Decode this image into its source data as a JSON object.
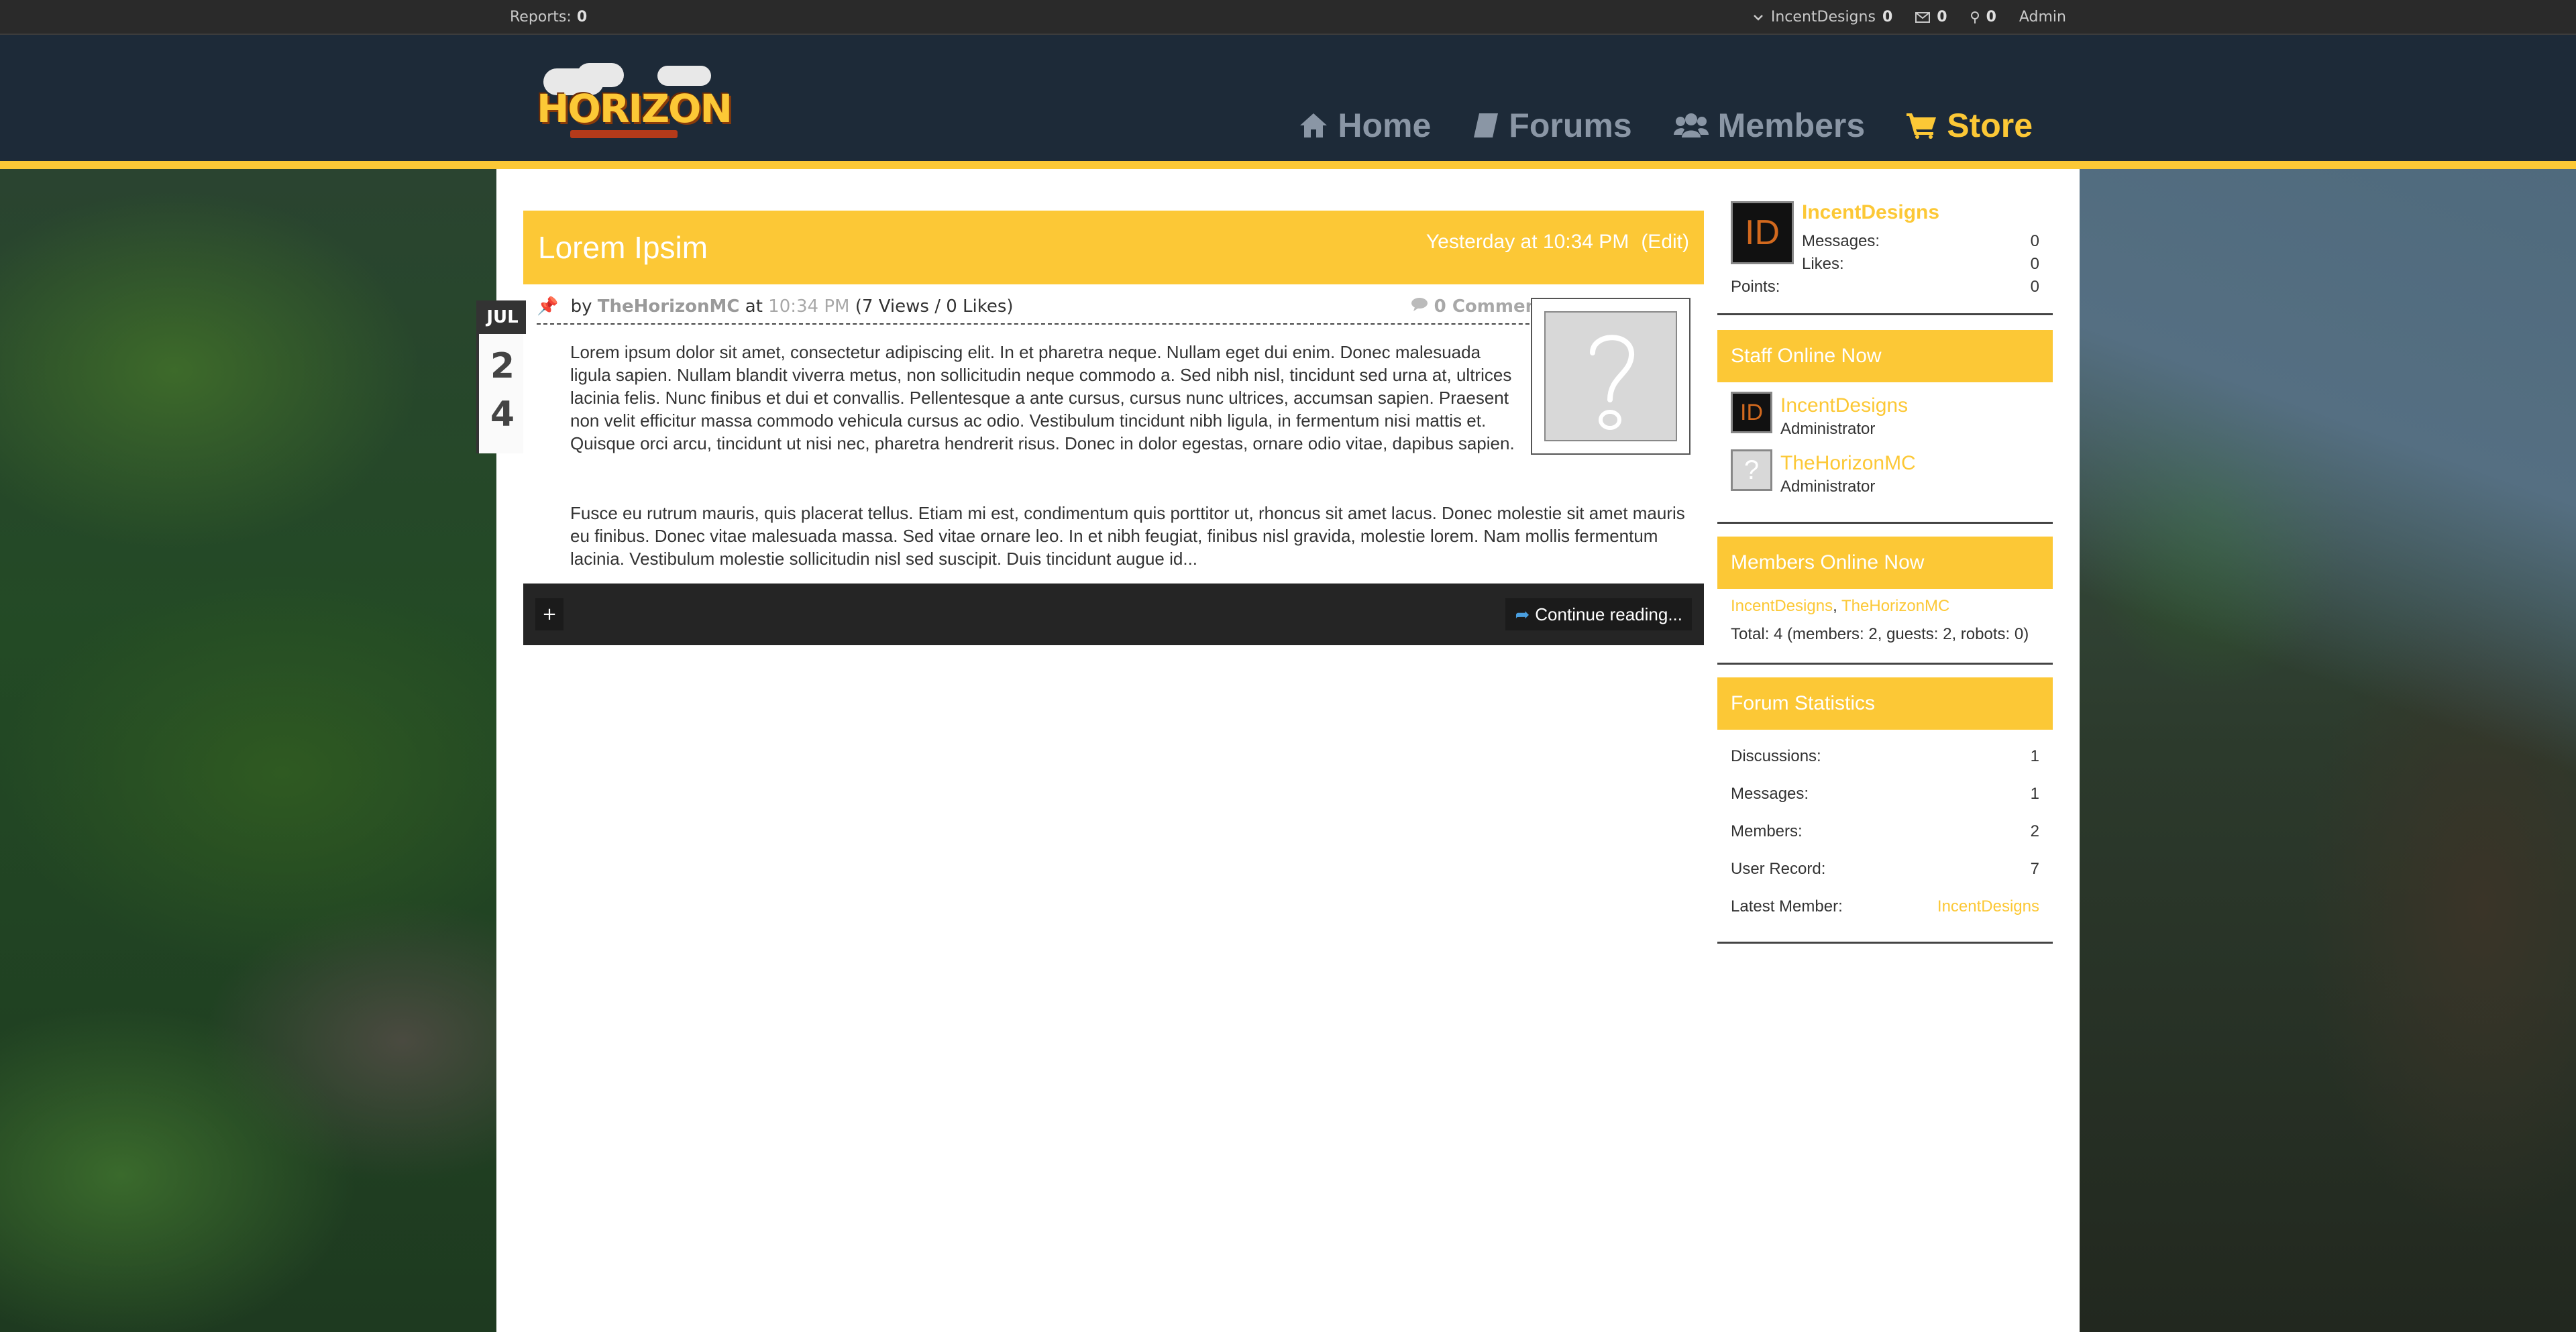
{
  "topbar": {
    "reports_label": "Reports:",
    "reports_count": "0",
    "user_name": "IncentDesigns",
    "user_count": "0",
    "inbox_count": "0",
    "alerts_count": "0",
    "admin_label": "Admin"
  },
  "header": {
    "logo_text": "HORIZON",
    "nav": [
      {
        "label": "Home",
        "icon": "home-icon"
      },
      {
        "label": "Forums",
        "icon": "book-icon"
      },
      {
        "label": "Members",
        "icon": "users-icon"
      },
      {
        "label": "Store",
        "icon": "cart-icon"
      }
    ]
  },
  "post": {
    "title": "Lorem Ipsim",
    "date": "Yesterday at 10:34 PM",
    "edit_label": "(Edit)",
    "calendar": {
      "month": "JUL",
      "day1": "2",
      "day2": "4"
    },
    "by_label": "by",
    "author": "TheHorizonMC",
    "at_label": "at",
    "time": "10:34 PM",
    "stats": "(7 Views / 0 Likes)",
    "comments": "0 Comments",
    "paragraph1": "Lorem ipsum dolor sit amet, consectetur adipiscing elit. In et pharetra neque. Nullam eget dui enim. Donec malesuada ligula sapien. Nullam blandit viverra metus, non sollicitudin neque commodo a. Sed nibh nisl, tincidunt sed urna at, ultrices lacinia felis. Nunc finibus et dui et convallis. Pellentesque a ante cursus, cursus nunc ultrices, accumsan sapien. Praesent non velit efficitur massa commodo vehicula cursus ac odio. Vestibulum tincidunt nibh ligula, in fermentum nisi mattis et. Quisque orci arcu, tincidunt ut nisi nec, pharetra hendrerit risus. Donec in dolor egestas, ornare odio vitae, dapibus sapien.",
    "paragraph2": "Fusce eu rutrum mauris, quis placerat tellus. Etiam mi est, condimentum quis porttitor ut, rhoncus sit amet lacus. Donec molestie sit amet mauris eu finibus. Donec vitae malesuada massa. Sed vitae ornare leo. In et nibh feugiat, finibus nisl gravida, molestie lorem. Nam mollis fermentum lacinia. Vestibulum molestie sollicitudin nisl sed suscipit. Duis tincidunt augue id...",
    "plus_label": "+",
    "continue_label": "Continue reading..."
  },
  "sidebar": {
    "user": {
      "avatar_text": "ID",
      "name": "IncentDesigns",
      "messages_label": "Messages:",
      "messages": "0",
      "likes_label": "Likes:",
      "likes": "0",
      "points_label": "Points:",
      "points": "0"
    },
    "staff": {
      "heading": "Staff Online Now",
      "members": [
        {
          "name": "IncentDesigns",
          "role": "Administrator",
          "avatar_text": "ID"
        },
        {
          "name": "TheHorizonMC",
          "role": "Administrator",
          "avatar_text": "?"
        }
      ]
    },
    "online": {
      "heading": "Members Online Now",
      "names": [
        "IncentDesigns",
        "TheHorizonMC"
      ],
      "separator": ",",
      "total": "Total: 4 (members: 2, guests: 2, robots: 0)"
    },
    "stats": {
      "heading": "Forum Statistics",
      "rows": [
        {
          "label": "Discussions:",
          "value": "1"
        },
        {
          "label": "Messages:",
          "value": "1"
        },
        {
          "label": "Members:",
          "value": "2"
        },
        {
          "label": "User Record:",
          "value": "7"
        },
        {
          "label": "Latest Member:",
          "value": "IncentDesigns"
        }
      ]
    }
  },
  "colors": {
    "accent": "#fcc836",
    "header_bg": "#1d2a38",
    "topbar_bg": "#2a2a2a",
    "dark_bar": "#252525"
  }
}
